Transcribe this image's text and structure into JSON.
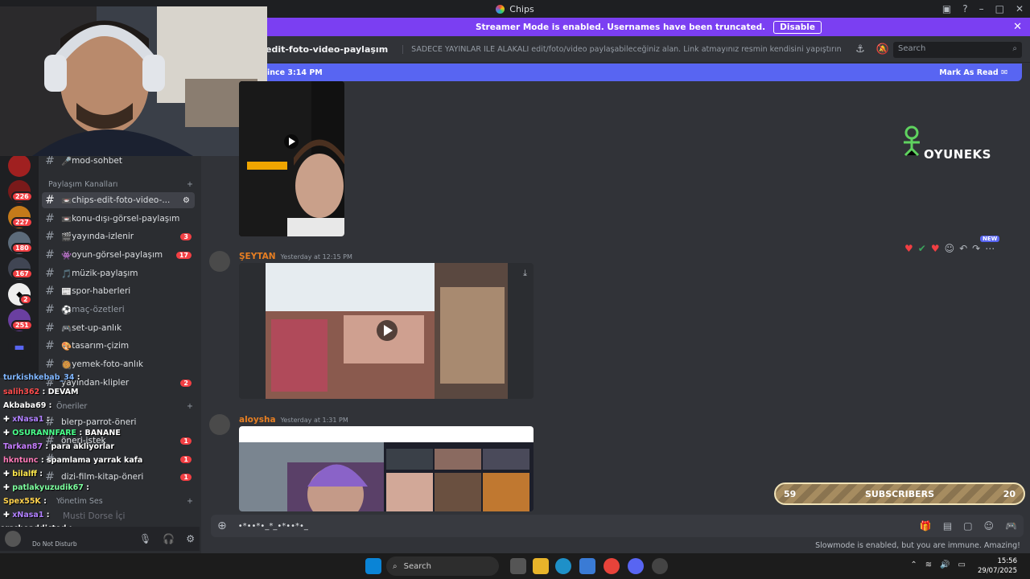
{
  "app": {
    "title": "Chips"
  },
  "banner": {
    "text": "Streamer Mode is enabled. Usernames have been truncated.",
    "button": "Disable"
  },
  "channel": {
    "name": "edit-foto-video-paylaşım",
    "topic": "SADECE YAYINLAR İLE ALAKALI edit/foto/video paylaşabileceğiniz alan. Link atmayınız resmin kendisini yapıştırın bu kanala lütfen, ...",
    "search_placeholder": "Search"
  },
  "new_bar": {
    "text": "ince 3:14 PM",
    "action": "Mark As Read"
  },
  "sidebar": {
    "channels_top": [
      {
        "label": "mod-sohbet",
        "emoji": "🎤"
      }
    ],
    "category1": "Paylaşım Kanalları",
    "channels": [
      {
        "label": "chips-edit-foto-video-...",
        "emoji": "📼",
        "active": true,
        "count": ""
      },
      {
        "label": "konu-dışı-görsel-paylaşım",
        "emoji": "📼",
        "count": ""
      },
      {
        "label": "yayında-izlenir",
        "emoji": "🎬",
        "count": "3"
      },
      {
        "label": "oyun-görsel-paylaşım",
        "emoji": "👾",
        "count": "17"
      },
      {
        "label": "müzik-paylaşım",
        "emoji": "🎵",
        "count": ""
      },
      {
        "label": "spor-haberleri",
        "emoji": "📰",
        "count": ""
      },
      {
        "label": "maç-özetleri",
        "emoji": "⚽",
        "count": ""
      },
      {
        "label": "set-up-anlık",
        "emoji": "🎮",
        "count": ""
      },
      {
        "label": "tasarım-çizim",
        "emoji": "🎨",
        "count": ""
      },
      {
        "label": "yemek-foto-anlık",
        "emoji": "🥘",
        "count": ""
      },
      {
        "label": "yayından-klipler",
        "emoji": "",
        "count": "2"
      }
    ],
    "category2": "Öneriler",
    "channels2": [
      {
        "label": "blerp-parrot-öneri",
        "count": ""
      },
      {
        "label": "öneri-istek",
        "count": "1"
      },
      {
        "label": "",
        "count": "1"
      },
      {
        "label": "dizi-film-kitap-öneri",
        "count": "1"
      }
    ],
    "category3": "Yönetim Ses",
    "voice": "Musti Dorse İçi"
  },
  "servers": [
    {
      "badge": ""
    },
    {
      "badge": "226"
    },
    {
      "badge": "227"
    },
    {
      "badge": "180"
    },
    {
      "badge": "167"
    },
    {
      "badge": "2"
    },
    {
      "badge": "251"
    },
    {
      "badge": ""
    }
  ],
  "chat_overlay": [
    {
      "user": "turkishkebab_34",
      "msg": "",
      "color": "#7fb6ff"
    },
    {
      "user": "salih362",
      "msg": "DEVAM",
      "color": "#ff4d4d"
    },
    {
      "user": "Akbaba69",
      "msg": "",
      "color": "#ffffff"
    },
    {
      "user": "xNasa1",
      "msg": "",
      "color": "#b180ff"
    },
    {
      "user": "OSURANNFARE",
      "msg": "BANANE",
      "color": "#49ff8a"
    },
    {
      "user": "Tarkan87",
      "msg": "para akliyorlar",
      "color": "#c77dff"
    },
    {
      "user": "hkntunc",
      "msg": "spamlama yarrak kafa",
      "color": "#ff7ab8"
    },
    {
      "user": "bilalff",
      "msg": "",
      "color": "#ffea4d"
    },
    {
      "user": "patlakyuzudik67",
      "msg": "",
      "color": "#7dff9e"
    },
    {
      "user": "Spex55K",
      "msg": "",
      "color": "#ffd24d"
    },
    {
      "user": "xNasa1",
      "msg": "",
      "color": "#b180ff"
    },
    {
      "user": "orscheaddicted",
      "msg": "",
      "color": "#ffffff"
    }
  ],
  "user_panel": {
    "status": "Do Not Disturb"
  },
  "messages": [
    {
      "author": "ŞEYTAN",
      "time": "Yesterday at 12:15 PM",
      "color": "#e67e22"
    },
    {
      "author": "aloysha",
      "time": "Yesterday at 1:31 PM",
      "color": "#e67e22"
    }
  ],
  "composer": {
    "text": "•*••*•_*_•*••*•_"
  },
  "slowmode": "Slowmode is enabled, but you are immune. Amazing!",
  "subs": {
    "left": "59",
    "label": "SUBSCRIBERS",
    "right": "20"
  },
  "overlay_logo": "OYUNEKS",
  "taskbar": {
    "search": "Search",
    "time": "15:56",
    "date": "29/07/2025"
  },
  "reactions_new": "NEW"
}
